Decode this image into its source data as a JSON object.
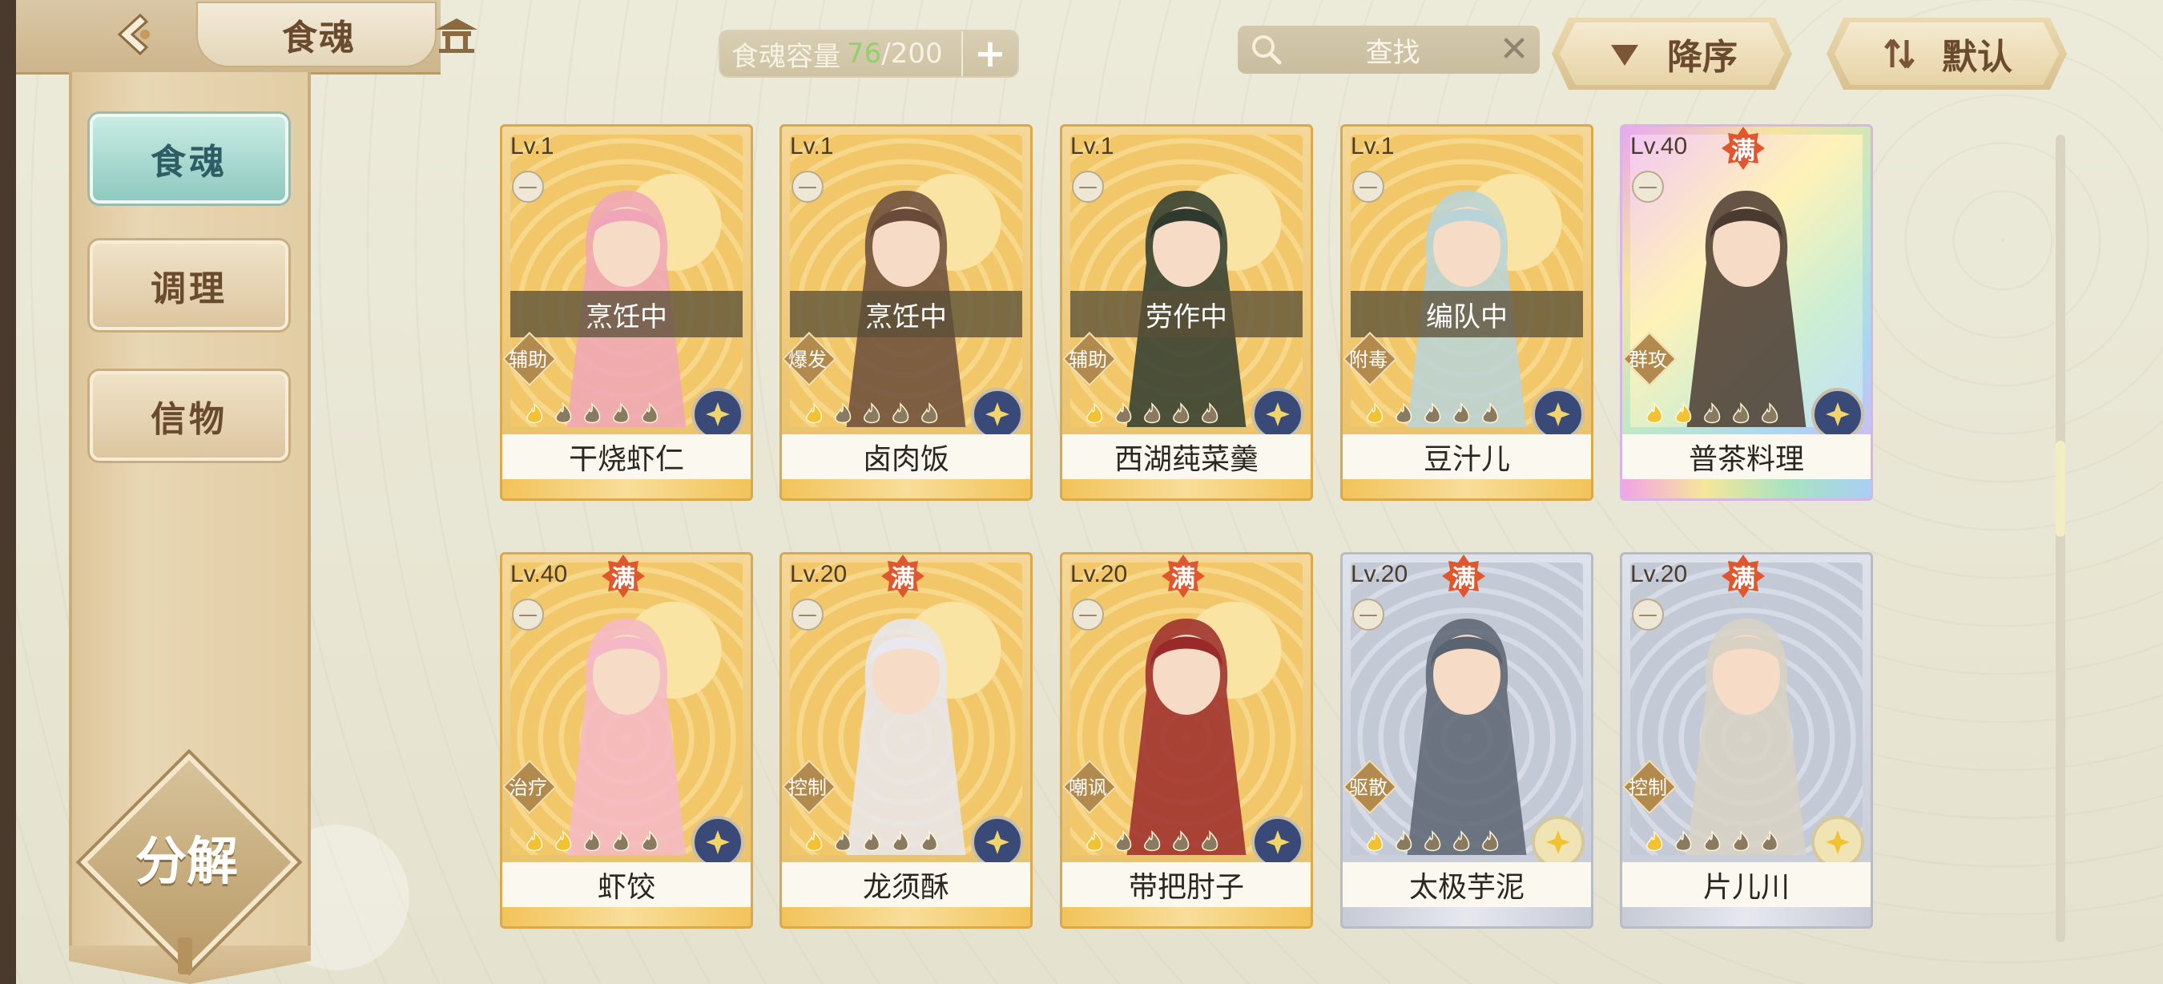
{
  "header": {
    "title": "食魂",
    "capacity": {
      "label": "食魂容量",
      "current": "76",
      "separator": "/",
      "max": "200",
      "add_label": "+"
    },
    "search": {
      "placeholder": "查找",
      "clear_label": "✕"
    },
    "sort_order": {
      "label": "降序"
    },
    "sort_mode": {
      "label": "默认"
    }
  },
  "sidebar": {
    "items": [
      {
        "label": "食魂",
        "active": true
      },
      {
        "label": "调理",
        "active": false
      },
      {
        "label": "信物",
        "active": false
      }
    ],
    "decompose_label": "分解"
  },
  "cards": [
    {
      "level": "Lv.1",
      "name": "干烧虾仁",
      "status": "烹饪中",
      "type": "辅助",
      "frame": "gold",
      "maxed": false,
      "element": "blue",
      "stars_lit": 1,
      "man": ""
    },
    {
      "level": "Lv.1",
      "name": "卤肉饭",
      "status": "烹饪中",
      "type": "爆发",
      "frame": "gold",
      "maxed": false,
      "element": "blue",
      "stars_lit": 1,
      "man": ""
    },
    {
      "level": "Lv.1",
      "name": "西湖莼菜羹",
      "status": "劳作中",
      "type": "辅助",
      "frame": "gold",
      "maxed": false,
      "element": "blue",
      "stars_lit": 1,
      "man": ""
    },
    {
      "level": "Lv.1",
      "name": "豆汁儿",
      "status": "编队中",
      "type": "附毒",
      "frame": "gold",
      "maxed": false,
      "element": "blue",
      "stars_lit": 1,
      "man": ""
    },
    {
      "level": "Lv.40",
      "name": "普茶料理",
      "status": "",
      "type": "群攻",
      "frame": "rainbow",
      "maxed": true,
      "element": "blue",
      "stars_lit": 2,
      "man": "满"
    },
    {
      "level": "Lv.40",
      "name": "虾饺",
      "status": "",
      "type": "治疗",
      "frame": "gold",
      "maxed": true,
      "element": "blue",
      "stars_lit": 2,
      "man": "满"
    },
    {
      "level": "Lv.20",
      "name": "龙须酥",
      "status": "",
      "type": "控制",
      "frame": "gold",
      "maxed": true,
      "element": "blue",
      "stars_lit": 1,
      "man": "满"
    },
    {
      "level": "Lv.20",
      "name": "带把肘子",
      "status": "",
      "type": "嘲讽",
      "frame": "gold",
      "maxed": true,
      "element": "blue",
      "stars_lit": 1,
      "man": "满"
    },
    {
      "level": "Lv.20",
      "name": "太极芋泥",
      "status": "",
      "type": "驱散",
      "frame": "silver",
      "maxed": true,
      "element": "gold",
      "stars_lit": 1,
      "man": "满"
    },
    {
      "level": "Lv.20",
      "name": "片儿川",
      "status": "",
      "type": "控制",
      "frame": "silver",
      "maxed": true,
      "element": "gold",
      "stars_lit": 1,
      "man": "满"
    }
  ],
  "colors": {
    "accent_green": "#8fd26a",
    "active_tab": "#8fc9bf",
    "brown_text": "#6b4b2e"
  }
}
